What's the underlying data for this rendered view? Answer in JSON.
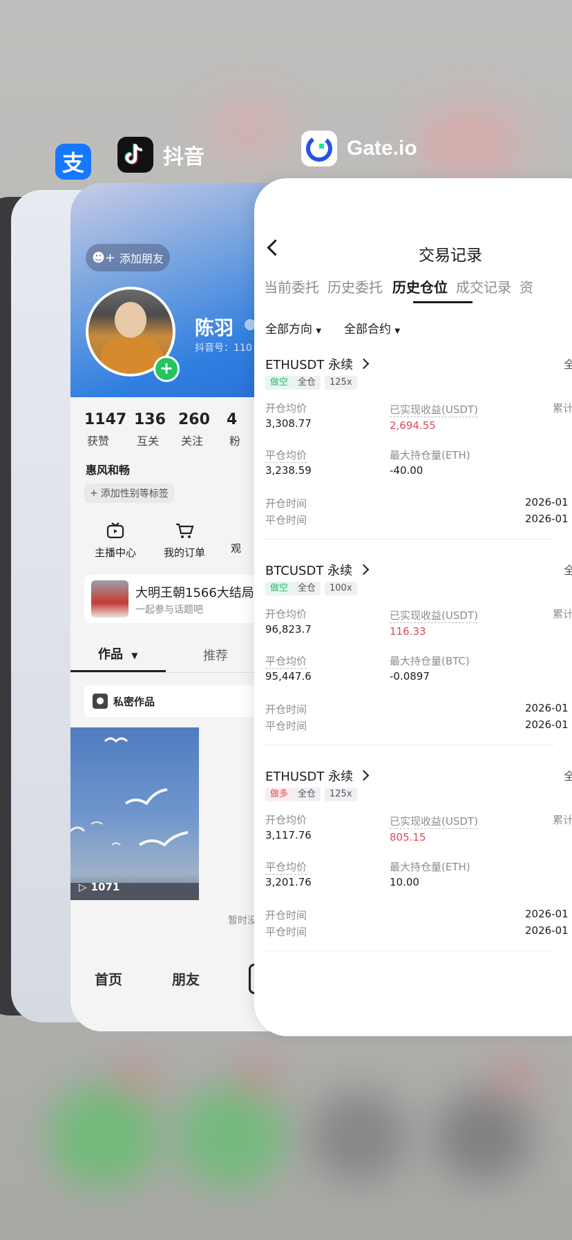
{
  "apps": {
    "alipay": {
      "icon": "alipay-icon",
      "glyph": "支"
    },
    "douyin": {
      "name": "抖音",
      "icon": "douyin-icon"
    },
    "gate": {
      "name": "Gate.io",
      "icon": "gate-icon"
    }
  },
  "douyin": {
    "add_friend": "添加朋友",
    "username": "陈羽",
    "douyin_id": "抖音号：110",
    "stats": [
      {
        "value": "1147",
        "label": "获赞"
      },
      {
        "value": "136",
        "label": "互关"
      },
      {
        "value": "260",
        "label": "关注"
      },
      {
        "value": "4",
        "label": "粉"
      }
    ],
    "bio": "惠风和畅",
    "add_tags": "添加性别等标签",
    "shortcuts": [
      {
        "label": "主播中心",
        "icon": "tv-icon"
      },
      {
        "label": "我的订单",
        "icon": "cart-icon"
      },
      {
        "label": "观",
        "icon": "eye-icon"
      }
    ],
    "topic": {
      "title": "大明王朝1566大结局",
      "subtitle": "一起参与话题吧"
    },
    "tabs": [
      "作品",
      "推荐"
    ],
    "private_works": "私密作品",
    "video_plays": "1071",
    "empty_hint": "暂时没",
    "bottom_nav": [
      "首页",
      "朋友"
    ]
  },
  "gate": {
    "title": "交易记录",
    "tabs": [
      "当前委托",
      "历史委托",
      "历史仓位",
      "成交记录",
      "资"
    ],
    "active_tab": 2,
    "filters": [
      "全部方向",
      "全部合约"
    ],
    "labels": {
      "avg_open": "开仓均价",
      "avg_close": "平仓均价",
      "realized_pnl": "已实现收益(USDT)",
      "cumulative": "累计",
      "open_time": "开仓时间",
      "close_time": "平仓时间",
      "close_all": "全"
    },
    "positions": [
      {
        "symbol": "ETHUSDT 永续",
        "side": "做空",
        "side_type": "short",
        "margin": "全仓",
        "leverage": "125x",
        "avg_open": "3,308.77",
        "avg_close": "3,238.59",
        "pnl": "2,694.55",
        "max_label": "最大持仓量(ETH)",
        "max_value": "-40.00",
        "open_time": "2026-01",
        "close_time": "2026-01"
      },
      {
        "symbol": "BTCUSDT 永续",
        "side": "做空",
        "side_type": "short",
        "margin": "全仓",
        "leverage": "100x",
        "avg_open": "96,823.7",
        "avg_close": "95,447.6",
        "pnl": "116.33",
        "max_label": "最大持仓量(BTC)",
        "max_value": "-0.0897",
        "open_time": "2026-01",
        "close_time": "2026-01"
      },
      {
        "symbol": "ETHUSDT 永续",
        "side": "做多",
        "side_type": "long",
        "margin": "全仓",
        "leverage": "125x",
        "avg_open": "3,117.76",
        "avg_close": "3,201.76",
        "pnl": "805.15",
        "max_label": "最大持仓量(ETH)",
        "max_value": "10.00",
        "open_time": "2026-01",
        "close_time": "2026-01"
      }
    ]
  }
}
